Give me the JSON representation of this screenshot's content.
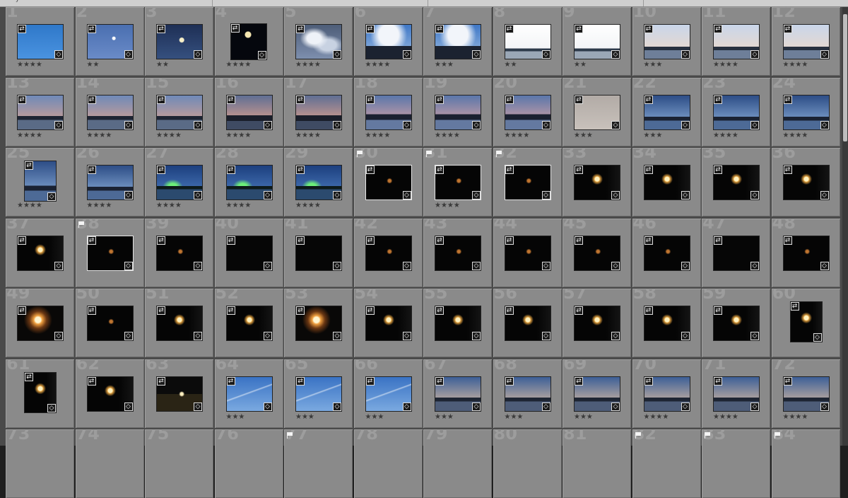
{
  "topbar": {
    "hint": "y"
  },
  "grid": {
    "rows": [
      {
        "cells": [
          {
            "n": "1",
            "scene": "blue-sky",
            "stars": "★★★★",
            "shape": "land"
          },
          {
            "n": "2",
            "scene": "blue-moon",
            "stars": "★★",
            "shape": "land"
          },
          {
            "n": "3",
            "scene": "dusk-moon",
            "stars": "★★",
            "shape": "land"
          },
          {
            "n": "4",
            "scene": "night-moon",
            "stars": "★★★★",
            "shape": "square"
          },
          {
            "n": "5",
            "scene": "clouds",
            "stars": "★★★★",
            "shape": "land"
          },
          {
            "n": "6",
            "scene": "city-clouds",
            "stars": "★★★★",
            "shape": "land"
          },
          {
            "n": "7",
            "scene": "city-clouds",
            "stars": "★★★",
            "shape": "land"
          },
          {
            "n": "8",
            "scene": "white-sky",
            "stars": "★★",
            "shape": "land"
          },
          {
            "n": "9",
            "scene": "white-sky",
            "stars": "★★",
            "shape": "land"
          },
          {
            "n": "10",
            "scene": "pale-sunset",
            "stars": "★★★",
            "shape": "land"
          },
          {
            "n": "11",
            "scene": "pale-sunset",
            "stars": "★★★★",
            "shape": "land"
          },
          {
            "n": "12",
            "scene": "pale-sunset",
            "stars": "★★★★",
            "shape": "land"
          }
        ]
      },
      {
        "cells": [
          {
            "n": "13",
            "scene": "sunset-bay",
            "stars": "★★★★",
            "shape": "land"
          },
          {
            "n": "14",
            "scene": "sunset-bay",
            "stars": "★★★★",
            "shape": "land"
          },
          {
            "n": "15",
            "scene": "sunset-bay",
            "stars": "★★★★",
            "shape": "land"
          },
          {
            "n": "16",
            "scene": "dusk-city",
            "stars": "★★★★",
            "shape": "land"
          },
          {
            "n": "17",
            "scene": "dusk-city",
            "stars": "★★★★",
            "shape": "land"
          },
          {
            "n": "18",
            "scene": "pink-city",
            "stars": "★★★★",
            "shape": "land"
          },
          {
            "n": "19",
            "scene": "pink-city",
            "stars": "★★★★",
            "shape": "land"
          },
          {
            "n": "20",
            "scene": "pink-city",
            "stars": "★★★★",
            "shape": "land"
          },
          {
            "n": "21",
            "scene": "grey",
            "stars": "★★★",
            "shape": "land"
          },
          {
            "n": "22",
            "scene": "blue-bay",
            "stars": "★★★",
            "shape": "land"
          },
          {
            "n": "23",
            "scene": "blue-bay",
            "stars": "★★★★",
            "shape": "land"
          },
          {
            "n": "24",
            "scene": "blue-bay",
            "stars": "★★★★",
            "shape": "land"
          }
        ]
      },
      {
        "cells": [
          {
            "n": "25",
            "scene": "blue-bay",
            "stars": "★★★★",
            "shape": "port"
          },
          {
            "n": "26",
            "scene": "blue-bay",
            "stars": "★★★★",
            "shape": "land"
          },
          {
            "n": "27",
            "scene": "green-lights",
            "stars": "★★★★",
            "shape": "land"
          },
          {
            "n": "28",
            "scene": "green-lights",
            "stars": "★★★★",
            "shape": "land"
          },
          {
            "n": "29",
            "scene": "green-lights",
            "stars": "★★★★",
            "shape": "land"
          },
          {
            "n": "30",
            "scene": "moon-dark",
            "stars": "",
            "shape": "land",
            "flag": true,
            "sel": true
          },
          {
            "n": "31",
            "scene": "moon-dark",
            "stars": "★★★★",
            "shape": "land",
            "flag": true,
            "sel": true
          },
          {
            "n": "32",
            "scene": "moon-dark",
            "stars": "",
            "shape": "land",
            "flag": true,
            "sel": true
          },
          {
            "n": "33",
            "scene": "moon-bright",
            "stars": "",
            "shape": "land"
          },
          {
            "n": "34",
            "scene": "moon-bright",
            "stars": "",
            "shape": "land"
          },
          {
            "n": "35",
            "scene": "moon-bright",
            "stars": "",
            "shape": "land"
          },
          {
            "n": "36",
            "scene": "moon-bright",
            "stars": "",
            "shape": "land"
          }
        ]
      },
      {
        "cells": [
          {
            "n": "37",
            "scene": "moon-bright",
            "stars": "",
            "shape": "land"
          },
          {
            "n": "38",
            "scene": "moon-dark",
            "stars": "",
            "shape": "land",
            "flag": true,
            "sel": true
          },
          {
            "n": "39",
            "scene": "moon-dark",
            "stars": "",
            "shape": "land"
          },
          {
            "n": "40",
            "scene": "black",
            "stars": "",
            "shape": "land"
          },
          {
            "n": "41",
            "scene": "black",
            "stars": "",
            "shape": "land"
          },
          {
            "n": "42",
            "scene": "moon-dark",
            "stars": "",
            "shape": "land"
          },
          {
            "n": "43",
            "scene": "moon-dark",
            "stars": "",
            "shape": "land"
          },
          {
            "n": "44",
            "scene": "moon-dark",
            "stars": "",
            "shape": "land"
          },
          {
            "n": "45",
            "scene": "moon-dark",
            "stars": "",
            "shape": "land"
          },
          {
            "n": "46",
            "scene": "moon-dark",
            "stars": "",
            "shape": "land"
          },
          {
            "n": "47",
            "scene": "black",
            "stars": "",
            "shape": "land"
          },
          {
            "n": "48",
            "scene": "moon-dark",
            "stars": "",
            "shape": "land"
          }
        ]
      },
      {
        "cells": [
          {
            "n": "49",
            "scene": "moon-glow",
            "stars": "",
            "shape": "land"
          },
          {
            "n": "50",
            "scene": "moon-dark",
            "stars": "",
            "shape": "land"
          },
          {
            "n": "51",
            "scene": "moon-bright",
            "stars": "",
            "shape": "land"
          },
          {
            "n": "52",
            "scene": "moon-bright",
            "stars": "",
            "shape": "land"
          },
          {
            "n": "53",
            "scene": "moon-glow",
            "stars": "",
            "shape": "land"
          },
          {
            "n": "54",
            "scene": "moon-bright",
            "stars": "",
            "shape": "land"
          },
          {
            "n": "55",
            "scene": "moon-bright",
            "stars": "",
            "shape": "land"
          },
          {
            "n": "56",
            "scene": "moon-bright",
            "stars": "",
            "shape": "land"
          },
          {
            "n": "57",
            "scene": "moon-bright",
            "stars": "",
            "shape": "land"
          },
          {
            "n": "58",
            "scene": "moon-bright",
            "stars": "",
            "shape": "land"
          },
          {
            "n": "59",
            "scene": "moon-bright",
            "stars": "",
            "shape": "land"
          },
          {
            "n": "60",
            "scene": "moon-bright",
            "stars": "",
            "shape": "port"
          }
        ]
      },
      {
        "cells": [
          {
            "n": "61",
            "scene": "moon-bright",
            "stars": "",
            "shape": "port"
          },
          {
            "n": "62",
            "scene": "moon-bright",
            "stars": "",
            "shape": "land"
          },
          {
            "n": "63",
            "scene": "city-night",
            "stars": "",
            "shape": "land"
          },
          {
            "n": "64",
            "scene": "contrail",
            "stars": "★★★",
            "shape": "land"
          },
          {
            "n": "65",
            "scene": "contrail",
            "stars": "★★★",
            "shape": "land"
          },
          {
            "n": "66",
            "scene": "contrail",
            "stars": "★★★",
            "shape": "land"
          },
          {
            "n": "67",
            "scene": "dawn-shore",
            "stars": "★★★",
            "shape": "land"
          },
          {
            "n": "68",
            "scene": "dawn-shore",
            "stars": "★★★",
            "shape": "land"
          },
          {
            "n": "69",
            "scene": "dawn-shore",
            "stars": "★★★",
            "shape": "land"
          },
          {
            "n": "70",
            "scene": "dawn-shore",
            "stars": "★★★★",
            "shape": "land"
          },
          {
            "n": "71",
            "scene": "dawn-shore",
            "stars": "★★★★",
            "shape": "land"
          },
          {
            "n": "72",
            "scene": "dawn-shore",
            "stars": "★★★★",
            "shape": "land"
          }
        ]
      },
      {
        "cells": [
          {
            "n": "73",
            "scene": "none",
            "stars": "",
            "shape": "land"
          },
          {
            "n": "74",
            "scene": "none",
            "stars": "",
            "shape": "land"
          },
          {
            "n": "75",
            "scene": "none",
            "stars": "",
            "shape": "land"
          },
          {
            "n": "76",
            "scene": "none",
            "stars": "",
            "shape": "land"
          },
          {
            "n": "77",
            "scene": "none",
            "stars": "",
            "shape": "land",
            "flag": true
          },
          {
            "n": "78",
            "scene": "none",
            "stars": "",
            "shape": "land"
          },
          {
            "n": "79",
            "scene": "none",
            "stars": "",
            "shape": "land"
          },
          {
            "n": "80",
            "scene": "none",
            "stars": "",
            "shape": "land"
          },
          {
            "n": "81",
            "scene": "none",
            "stars": "",
            "shape": "land"
          },
          {
            "n": "82",
            "scene": "none",
            "stars": "",
            "shape": "land",
            "flag": true
          },
          {
            "n": "83",
            "scene": "none",
            "stars": "",
            "shape": "land",
            "flag": true
          },
          {
            "n": "84",
            "scene": "none",
            "stars": "",
            "shape": "land",
            "flag": true
          }
        ]
      }
    ]
  },
  "icons": {
    "transform": "sync-icon",
    "keyword": "tag-icon",
    "crop": "crop-icon",
    "flag": "flag-icon"
  }
}
